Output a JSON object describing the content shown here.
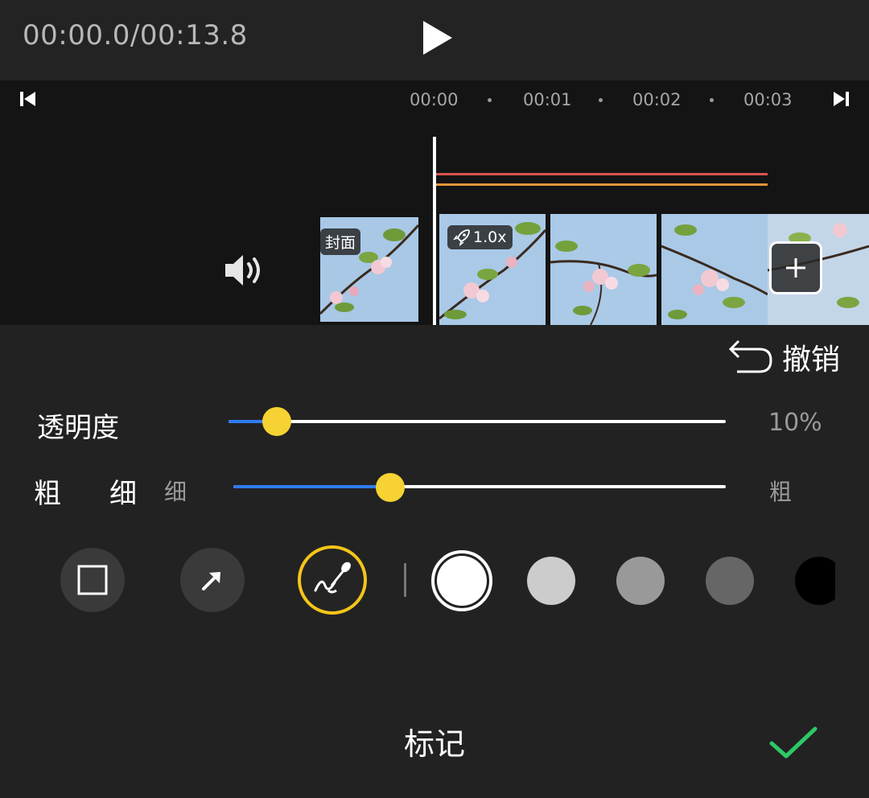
{
  "header": {
    "timecode": "00:00.0/00:13.8",
    "play_icon": "play-icon"
  },
  "timeline": {
    "ruler_ticks": [
      "00:00",
      "00:01",
      "00:02",
      "00:03"
    ],
    "cover_label": "封面",
    "speed_label": "1.0x",
    "icons": [
      "skip-to-start-icon",
      "skip-to-end-icon",
      "volume-icon",
      "rocket-icon",
      "plus-icon"
    ],
    "track_colors": {
      "red": "#d9534f",
      "orange": "#e8943a"
    }
  },
  "panel": {
    "undo_label": "撤销",
    "opacity": {
      "label": "透明度",
      "value_text": "10%",
      "value_percent": 10
    },
    "thickness": {
      "label_left": "粗",
      "label_right": "细",
      "min_label": "细",
      "max_label": "粗",
      "level_percent": 32
    },
    "tools": [
      "rectangle-tool",
      "arrow-tool",
      "brush-tool"
    ],
    "selected_tool": "brush-tool",
    "colors": [
      "#ffffff",
      "#cccccc",
      "#999999",
      "#666666",
      "#000000"
    ],
    "selected_color": "#ffffff",
    "accent": "#f6d332",
    "slider_fill": "#2f7bf0"
  },
  "footer": {
    "title": "标记",
    "confirm_icon": "check-icon",
    "confirm_color": "#2ec866"
  }
}
